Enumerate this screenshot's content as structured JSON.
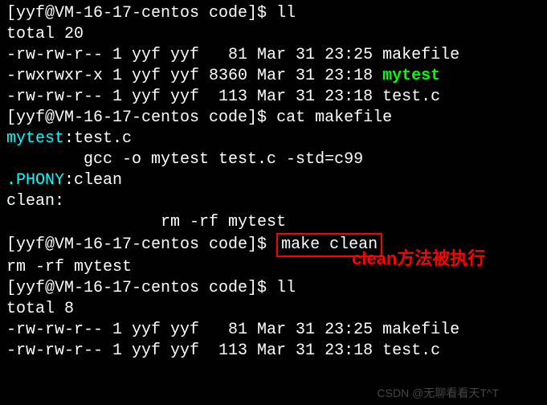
{
  "prompt1": "[yyf@VM-16-17-centos code]$ ",
  "cmd1": "ll",
  "total1": "total 20",
  "ls1": {
    "row1": "-rw-rw-r-- 1 yyf yyf   81 Mar 31 23:25 makefile",
    "row2_perms": "-rwxrwxr-x 1 yyf yyf 8360 Mar 31 23:18 ",
    "row2_name": "mytest",
    "row3": "-rw-rw-r-- 1 yyf yyf  113 Mar 31 23:18 test.c"
  },
  "prompt2": "[yyf@VM-16-17-centos code]$ ",
  "cmd2": "cat makefile",
  "makefile": {
    "line1_pre": "mytest",
    "line1_colon": ":",
    "line1_post": "test.c",
    "line2": "        gcc -o mytest test.c -std=c99",
    "line3_pre": ".PHONY",
    "line3_colon": ":",
    "line3_post": "clean",
    "line4": "clean:",
    "line5": "                rm -rf mytest"
  },
  "annotation_text": "clean方法被执行",
  "prompt3": "[yyf@VM-16-17-centos code]$ ",
  "cmd3": "make clean",
  "output3": "rm -rf mytest",
  "prompt4": "[yyf@VM-16-17-centos code]$ ",
  "cmd4": "ll",
  "total2": "total 8",
  "ls2": {
    "row1": "-rw-rw-r-- 1 yyf yyf   81 Mar 31 23:25 makefile",
    "row2": "-rw-rw-r-- 1 yyf yyf  113 Mar 31 23:18 test.c"
  },
  "watermark": "CSDN @无聊看看天T^T"
}
